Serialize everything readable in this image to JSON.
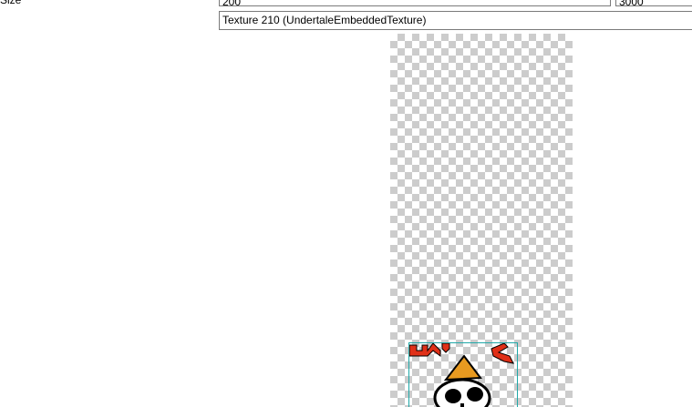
{
  "properties": {
    "size_label": "Size",
    "size_width_value": "200",
    "size_height_value": "3000",
    "texture_value": "Texture 210 (UndertaleEmbeddedTexture)"
  },
  "preview": {
    "background": "transparency-checkerboard",
    "sprite_icon": "skull-party-hat-sprite",
    "bounds_color": "#20a8a8"
  }
}
